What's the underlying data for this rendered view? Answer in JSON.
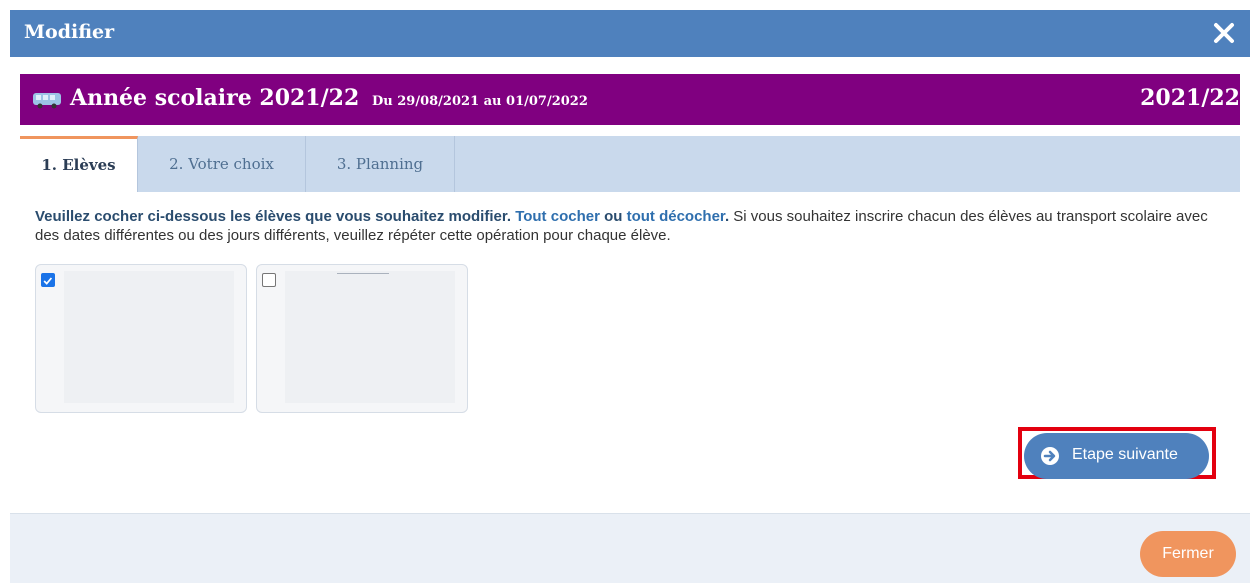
{
  "dialog": {
    "title": "Modifier",
    "close_icon": "close-icon"
  },
  "year": {
    "icon": "bus-icon",
    "title": "Année scolaire 2021/22",
    "dates": "Du 29/08/2021 au 01/07/2022",
    "code": "2021/22",
    "color": "#800080"
  },
  "tabs": [
    {
      "label": "1. Elèves",
      "active": true
    },
    {
      "label": "2. Votre choix",
      "active": false
    },
    {
      "label": "3. Planning",
      "active": false
    }
  ],
  "instruction": {
    "bold": "Veuillez cocher ci-dessous les élèves que vous souhaitez modifier.",
    "check_all": "Tout cocher",
    "ou": "ou",
    "uncheck_all": "tout décocher",
    "period": ".",
    "rest": "Si vous souhaitez inscrire chacun des élèves au transport scolaire avec des dates différentes ou des jours différents, veuillez répéter cette opération pour chaque élève."
  },
  "students": [
    {
      "checked": true
    },
    {
      "checked": false
    }
  ],
  "actions": {
    "next_label": "Etape suivante",
    "next_icon": "arrow-circle-right-icon",
    "close_label": "Fermer"
  },
  "colors": {
    "header": "#4f81bd",
    "accent": "#f0955e",
    "highlight": "#e3000f"
  }
}
